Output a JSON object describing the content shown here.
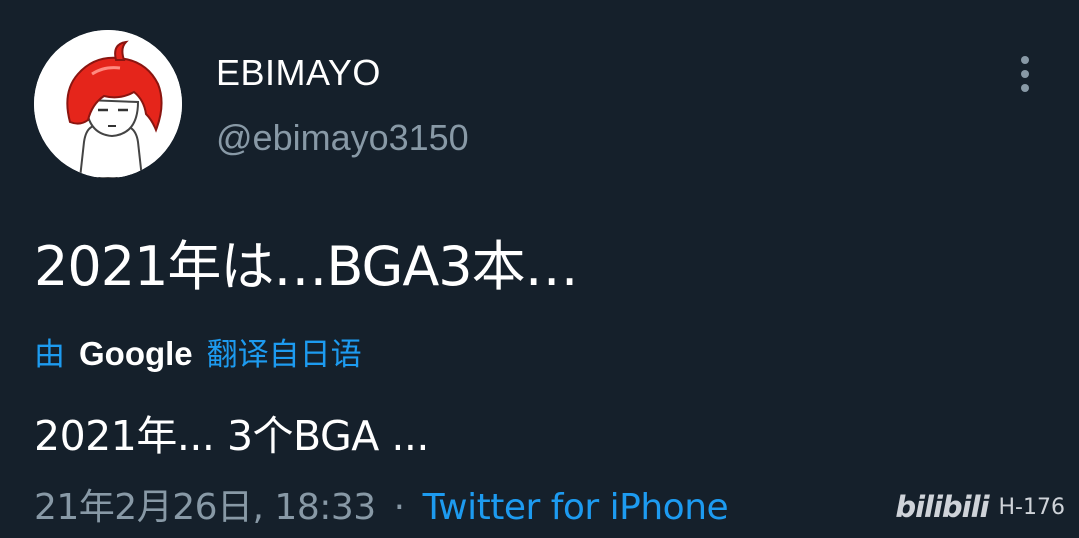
{
  "user": {
    "display_name": "EBIMAYO",
    "handle": "@ebimayo3150"
  },
  "menu": {
    "icon": "more-vertical-icon"
  },
  "tweet": {
    "text": "2021年は…BGA3本…"
  },
  "translation": {
    "by_label": "由",
    "provider": "Google",
    "from_label": "翻译自日语",
    "text": "2021年... 3个BGA ..."
  },
  "meta": {
    "timestamp": "21年2月26日, 18:33",
    "separator": "·",
    "source": "Twitter for iPhone"
  },
  "watermark": {
    "logo": "bilibili",
    "code": "H-176"
  },
  "colors": {
    "background": "#15202b",
    "secondary_text": "#8899a6",
    "accent": "#1d9bf0"
  }
}
